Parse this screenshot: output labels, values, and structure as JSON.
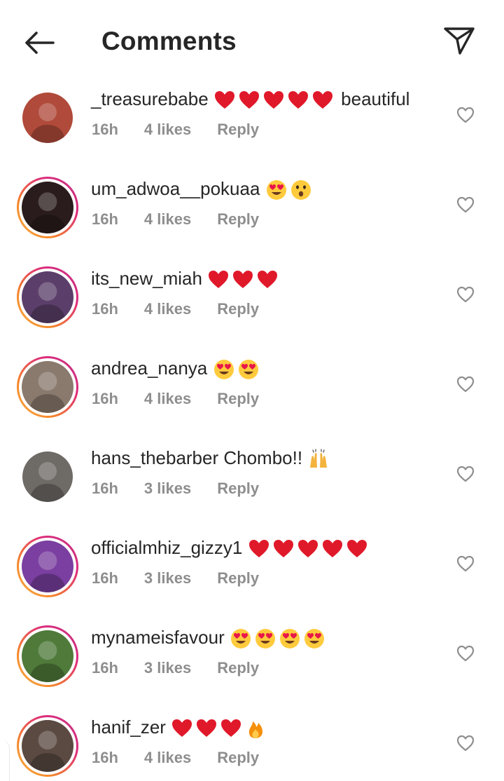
{
  "header": {
    "title": "Comments",
    "back_icon": "back-arrow-icon",
    "send_icon": "paper-plane-icon"
  },
  "colors": {
    "text": "#262626",
    "meta": "#8e8e8e",
    "heart_emoji": "#e0192a",
    "story_ring_start": "#f9b24a",
    "story_ring_end": "#c13584"
  },
  "comments": [
    {
      "username": "_treasurebabe",
      "emojis": [
        "red-heart",
        "red-heart",
        "red-heart",
        "red-heart",
        "red-heart"
      ],
      "text": " beautiful",
      "time": "16h",
      "likes": "4 likes",
      "reply": "Reply",
      "story": false,
      "avatar_color": "#b04a3a"
    },
    {
      "username": "um_adwoa__pokuaa",
      "emojis": [
        "heart-eyes",
        "astonished"
      ],
      "text": "",
      "time": "16h",
      "likes": "4 likes",
      "reply": "Reply",
      "story": true,
      "avatar_color": "#2a1c1c"
    },
    {
      "username": "its_new_miah",
      "emojis": [
        "red-heart",
        "red-heart",
        "red-heart"
      ],
      "text": "",
      "time": "16h",
      "likes": "4 likes",
      "reply": "Reply",
      "story": true,
      "avatar_color": "#5b3f6a"
    },
    {
      "username": "andrea_nanya",
      "emojis": [
        "heart-eyes",
        "heart-eyes"
      ],
      "text": "",
      "time": "16h",
      "likes": "4 likes",
      "reply": "Reply",
      "story": true,
      "avatar_color": "#8a7a6e"
    },
    {
      "username": "hans_thebarber",
      "emojis": [],
      "text": " Chombo!! ",
      "trailing_emojis": [
        "raised-hands"
      ],
      "time": "16h",
      "likes": "3 likes",
      "reply": "Reply",
      "story": false,
      "avatar_color": "#6e6a66"
    },
    {
      "username": "officialmhiz_gizzy1",
      "emojis": [
        "red-heart",
        "red-heart",
        "red-heart",
        "red-heart",
        "red-heart"
      ],
      "text": "",
      "time": "16h",
      "likes": "3 likes",
      "reply": "Reply",
      "story": true,
      "avatar_color": "#7a3fa0"
    },
    {
      "username": "mynameisfavour",
      "emojis": [
        "heart-eyes",
        "heart-eyes",
        "heart-eyes",
        "heart-eyes"
      ],
      "text": "",
      "time": "16h",
      "likes": "3 likes",
      "reply": "Reply",
      "story": true,
      "avatar_color": "#4f7a3a"
    },
    {
      "username": "hanif_zer",
      "emojis": [
        "red-heart",
        "red-heart",
        "red-heart",
        "fire"
      ],
      "text": "",
      "time": "16h",
      "likes": "4 likes",
      "reply": "Reply",
      "story": true,
      "avatar_color": "#5a4a42"
    }
  ]
}
